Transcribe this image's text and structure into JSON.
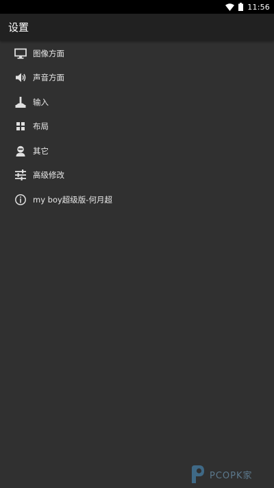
{
  "status_bar": {
    "time": "11:56",
    "icons": [
      "wifi-icon",
      "battery-icon"
    ]
  },
  "app_bar": {
    "title": "设置"
  },
  "menu": {
    "items": [
      {
        "label": "图像方面",
        "icon": "monitor-icon"
      },
      {
        "label": "声音方面",
        "icon": "speaker-icon"
      },
      {
        "label": "输入",
        "icon": "joystick-icon"
      },
      {
        "label": "布局",
        "icon": "grid-icon"
      },
      {
        "label": "其它",
        "icon": "person-icon"
      },
      {
        "label": "高级修改",
        "icon": "sliders-icon"
      },
      {
        "label": "my boy超级版-何月超",
        "icon": "info-icon"
      }
    ]
  },
  "watermark": {
    "text": "PCOPK家"
  },
  "colors": {
    "background": "#303030",
    "app_bar": "#212121",
    "status_bar": "#000000",
    "text": "#ffffff"
  }
}
